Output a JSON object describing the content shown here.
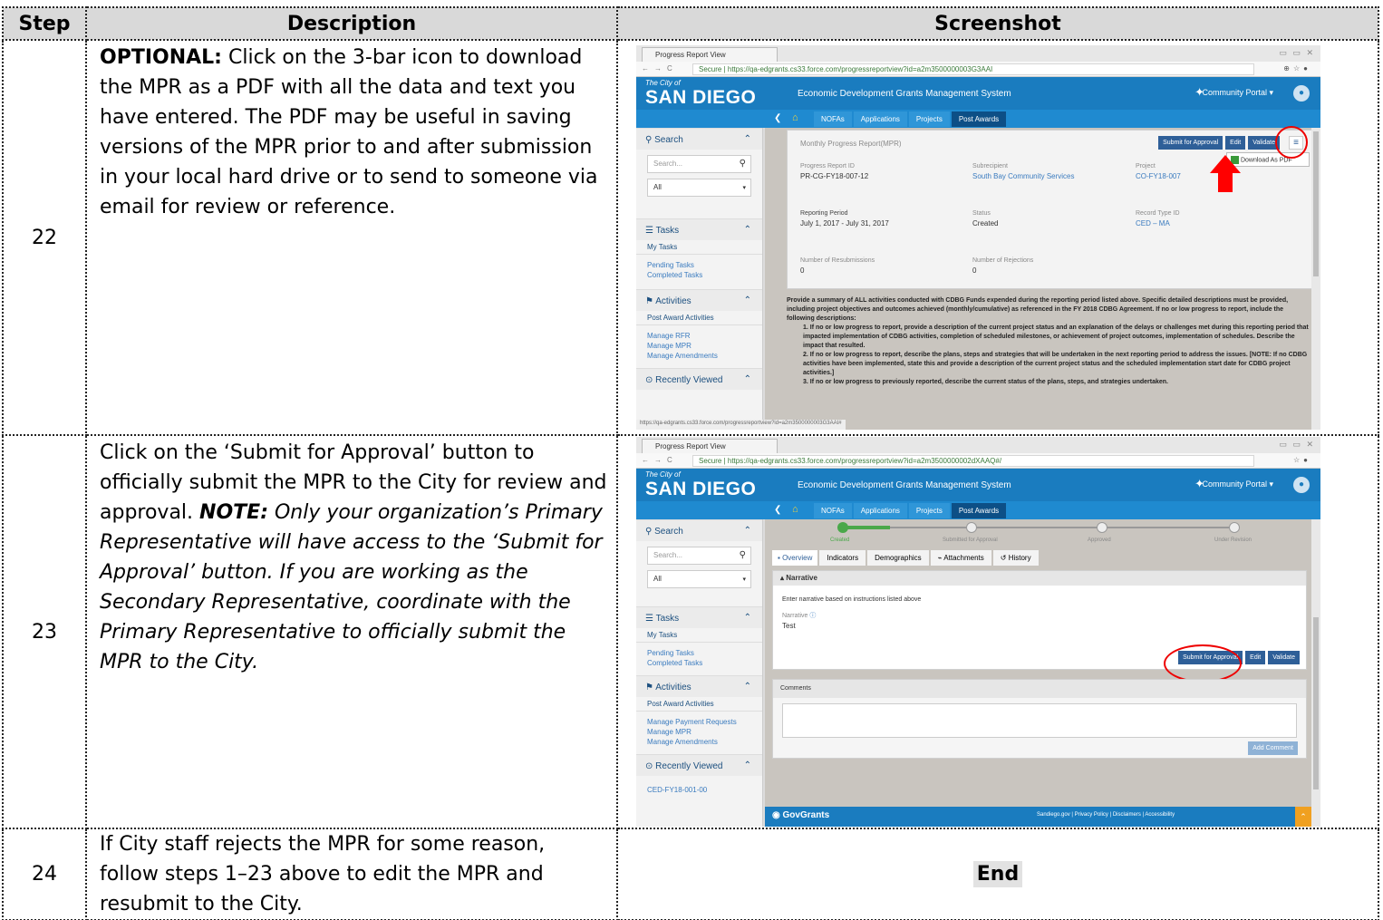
{
  "headers": {
    "step": "Step",
    "description": "Description",
    "screenshot": "Screenshot"
  },
  "rows": [
    {
      "step": "22",
      "desc_bold": "OPTIONAL:",
      "desc": " Click on the 3-bar icon to download the MPR as a PDF with all the data and text you have entered. The PDF may be useful in saving versions of the MPR prior to and after submission in your local hard drive or to send to someone via email for review or reference."
    },
    {
      "step": "23",
      "desc": "Click on the ‘Submit for Approval’ button to officially submit the MPR to the City for review and approval. ",
      "desc_note": "NOTE:",
      "desc_italic": " Only your organization’s Primary Representative will have access to the ‘Submit for Approval’ button. If you are working as the Secondary Representative, coordinate with the Primary Representative to officially submit the MPR to the City."
    },
    {
      "step": "24",
      "desc": "If City staff rejects the MPR for some reason, follow steps 1–23 above to edit the MPR and resubmit to the City.",
      "end_label": "End"
    }
  ],
  "shot1": {
    "tab_title": "Progress Report View",
    "url": "Secure | https://qa-edgrants.cs33.force.com/progressreportview?id=a2m3500000003G3AAI",
    "logo_small": "The City of",
    "logo_big": "SAN DIEGO",
    "system_name": "Economic Development Grants Management System",
    "portal": "Community Portal ▾",
    "nav_tabs": [
      "NOFAs",
      "Applications",
      "Projects",
      "Post Awards"
    ],
    "sidebar": {
      "search": "Search",
      "search_placeholder": "Search...",
      "filter": "All",
      "tasks": "Tasks",
      "my_tasks": "My Tasks",
      "task_links": [
        "Pending Tasks",
        "Completed Tasks"
      ],
      "activities": "Activities",
      "post_award": "Post Award Activities",
      "activity_links": [
        "Manage RFR",
        "Manage MPR",
        "Manage Amendments"
      ],
      "recent": "Recently Viewed"
    },
    "card_title": "Monthly Progress Report(MPR)",
    "buttons": [
      "Submit for Approval",
      "Edit",
      "Validate"
    ],
    "dropdown_item": "Download As PDF",
    "fields": [
      {
        "label": "Progress Report ID",
        "value": "PR-CG-FY18-007-12"
      },
      {
        "label": "Subrecipient",
        "value": "South Bay Community Services"
      },
      {
        "label": "Project",
        "value": "CO-FY18-007"
      },
      {
        "label": "Reporting Period",
        "value": "July 1, 2017 - July 31, 2017"
      },
      {
        "label": "Status",
        "value": "Created"
      },
      {
        "label": "Record Type ID",
        "value": "CED – MA"
      },
      {
        "label": "Number of Resubmissions",
        "value": "0"
      },
      {
        "label": "Number of Rejections",
        "value": "0"
      }
    ],
    "narrative_intro": "Provide a summary of ALL activities conducted with CDBG Funds expended during the reporting period listed above. Specific detailed descriptions must be provided, including project objectives and outcomes achieved (monthly/cumulative) as referenced in the FY 2018 CDBG Agreement. If no or low progress to report, include the following descriptions:",
    "narrative_items": [
      "1. If no or low progress to report, provide a description of the current project status and an explanation of the delays or challenges met during this reporting period that impacted implementation of CDBG activities, completion of scheduled milestones, or achievement of project outcomes, implementation of schedules. Describe the impact that resulted.",
      "2. If no or low progress to report, describe the plans, steps and strategies that will be undertaken in the next reporting period to address the issues. [NOTE: If no CDBG activities have been implemented, state this and provide a description of the current project status and the scheduled implementation start date for CDBG project activities.]",
      "3. If no or low progress to previously reported, describe the current status of the plans, steps, and strategies undertaken."
    ],
    "status_url": "https://qa-edgrants.cs33.force.com/progressreportview?id=a2m3500000003G3AAI#"
  },
  "shot2": {
    "tab_title": "Progress Report View",
    "url": "Secure | https://qa-edgrants.cs33.force.com/progressreportview?id=a2m3500000002dXAAQ#/",
    "progress_steps": [
      "Created",
      "Submitted for Approval",
      "Approved",
      "Under Revision"
    ],
    "progress_fraction": 0.12,
    "tabs": [
      "Overview",
      "Indicators",
      "Demographics",
      "Attachments",
      "History"
    ],
    "narrative_header": "Narrative",
    "narrative_instr": "Enter narrative based on instructions listed above",
    "narrative_label": "Narrative",
    "narrative_value": "Test",
    "buttons": [
      "Submit for Approval",
      "Edit",
      "Validate"
    ],
    "comments": "Comments",
    "add_comment": "Add Comment",
    "activity_links": [
      "Manage Payment Requests",
      "Manage MPR",
      "Manage Amendments"
    ],
    "recent_item": "CED-FY18-001-00",
    "footer_brand": "GovGrants",
    "footer_links": "Sandiego.gov | Privacy Policy | Disclaimers | Accessibility"
  }
}
